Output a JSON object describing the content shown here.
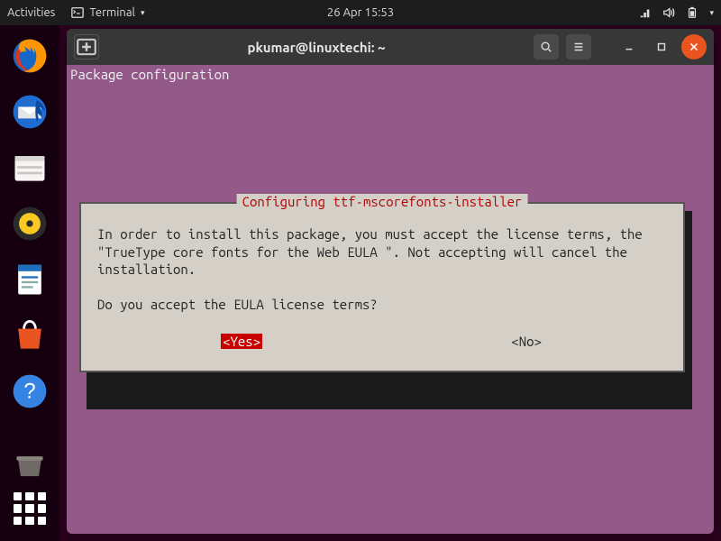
{
  "topbar": {
    "activities": "Activities",
    "app_name": "Terminal",
    "datetime": "26 Apr  15:53"
  },
  "dock": {
    "items": [
      "firefox",
      "thunderbird",
      "files",
      "rhythmbox",
      "writer",
      "software",
      "help"
    ],
    "grid_label": "Show Applications"
  },
  "window": {
    "title": "pkumar@linuxtechi: ~",
    "new_tab_tooltip": "New Tab",
    "search_tooltip": "Search",
    "menu_tooltip": "Menu",
    "min_tooltip": "Minimize",
    "max_tooltip": "Maximize",
    "close_tooltip": "Close"
  },
  "terminal": {
    "header": "Package configuration",
    "dialog": {
      "title": "Configuring ttf-mscorefonts-installer",
      "body": "In order to install this package, you must accept the license terms, the \"TrueType core fonts for the Web EULA \". Not accepting will cancel the installation.\n\nDo you accept the EULA license terms?",
      "yes": "<Yes>",
      "no": "<No>"
    }
  }
}
